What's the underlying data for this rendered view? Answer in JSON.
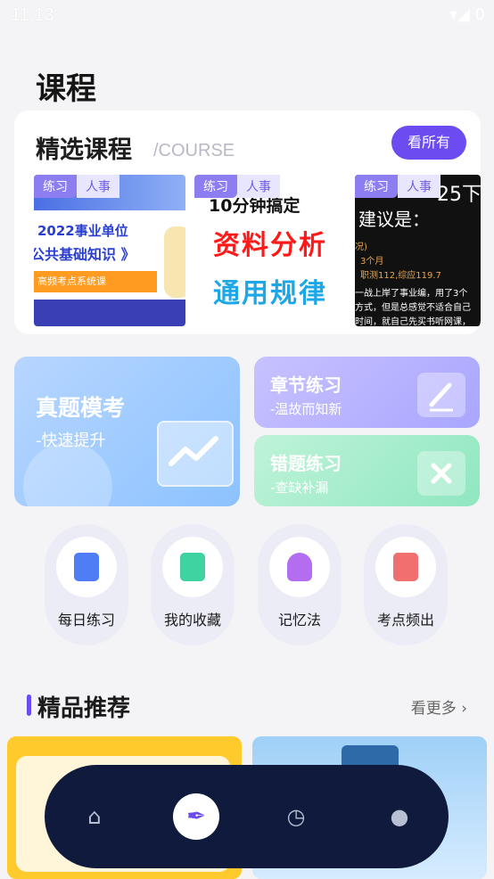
{
  "status": {
    "time": "11:13",
    "icons": "▾◢ 0"
  },
  "page": {
    "title": "课程"
  },
  "course": {
    "title": "精选课程",
    "subtitle_en": "/COURSE",
    "see_all": "看所有",
    "items": [
      {
        "tag": "练习",
        "cat": "人事",
        "line1": "2022事业单位",
        "line2": "公共基础知识 》",
        "line3": "高频考点系统课"
      },
      {
        "tag": "练习",
        "cat": "人事",
        "line1": "10分钟搞定",
        "line2": "资料分析",
        "line3": "通用规律"
      },
      {
        "tag": "练习",
        "cat": "人事",
        "line0": "25下",
        "line1": "建议是：",
        "a": "况)",
        "b": "3个月",
        "c": "职测112,综应119.7",
        "d": "一战上岸了事业编，用了3个",
        "e": "方式，但是总感觉不适合自己",
        "f": "时间，就自己先买书听网课，"
      }
    ]
  },
  "practice": {
    "main": {
      "title": "真题模考",
      "sub": "-快速提升"
    },
    "chapter": {
      "title": "章节练习",
      "sub": "-温故而知新"
    },
    "wrong": {
      "title": "错题练习",
      "sub": "-查缺补漏"
    }
  },
  "quick": [
    {
      "label": "每日练习",
      "icon": "clipboard-icon",
      "color": "#4f7df5"
    },
    {
      "label": "我的收藏",
      "icon": "bookmark-book-icon",
      "color": "#3ed3a0"
    },
    {
      "label": "记忆法",
      "icon": "brain-head-icon",
      "color": "#b46cf0"
    },
    {
      "label": "考点频出",
      "icon": "calendar-plus-icon",
      "color": "#f26f6f"
    }
  ],
  "recommend": {
    "title": "精品推荐",
    "more": "看更多"
  },
  "nav": {
    "home": "⌂",
    "course": "✒",
    "history": "◷",
    "profile": "●"
  },
  "colors": {
    "accent": "#6c4cf0",
    "nav_bg": "#0f1a3d"
  }
}
